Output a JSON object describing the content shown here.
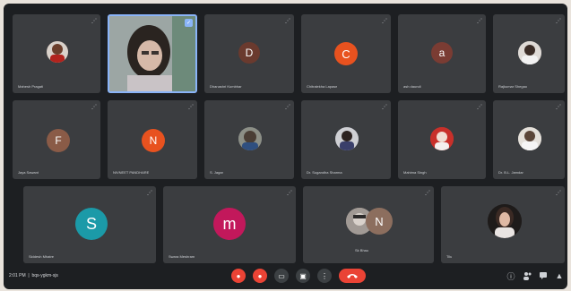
{
  "meeting": {
    "time": "2:01 PM",
    "code": "bqs-ygkm-sjs"
  },
  "participants": [
    {
      "name": "Mahesh Pragati",
      "avatar": "photo",
      "color": "#7a4b38"
    },
    {
      "name": "",
      "avatar": "video",
      "color": "#9aa3a6"
    },
    {
      "name": "Dhanashri Kumbhar",
      "avatar": "D",
      "color": "#6a3a2e"
    },
    {
      "name": "Chitralekha Lapase",
      "avatar": "C",
      "color": "#e8521f"
    },
    {
      "name": "ash daundi",
      "avatar": "a",
      "color": "#7a3c33"
    },
    {
      "name": "Rajkumar Shegao",
      "avatar": "photo",
      "color": "#b9b3ad"
    },
    {
      "name": "Jaya Sawant",
      "avatar": "F",
      "color": "#8a5b47"
    },
    {
      "name": "NIVNEET PANDHARE",
      "avatar": "N",
      "color": "#e8521f"
    },
    {
      "name": "S. Jagar",
      "avatar": "photo",
      "color": "#6d7584"
    },
    {
      "name": "Dr. Sugandha Sharma",
      "avatar": "photo",
      "color": "#4c5468"
    },
    {
      "name": "Mahima Singh",
      "avatar": "photo",
      "color": "#c23a31"
    },
    {
      "name": "Dr. B.L. Jamdar",
      "avatar": "photo",
      "color": "#b8b0a4"
    },
    {
      "name": "Siddesh Mhatre",
      "avatar": "S",
      "color": "#1b9aa8"
    },
    {
      "name": "Swara Meshram",
      "avatar": "m",
      "color": "#c2185b"
    },
    {
      "name": "Sk Bhau",
      "avatar": "group",
      "color": "#9a8c82"
    },
    {
      "name": "Tilu",
      "avatar": "photo",
      "color": "#2a2422"
    }
  ],
  "colors": {
    "background": "#1d1f22",
    "tile": "#3b3d40",
    "danger": "#ea4335",
    "active_border": "#8ab4f8"
  },
  "controls": [
    {
      "icon": "mic-off-icon",
      "glyph": "●"
    },
    {
      "icon": "camera-off-icon",
      "glyph": "●"
    },
    {
      "icon": "captions-icon",
      "glyph": "▭"
    },
    {
      "icon": "present-icon",
      "glyph": "▣"
    },
    {
      "icon": "more-options-icon",
      "glyph": "⋮"
    }
  ],
  "end_call_icon": "end-call-icon"
}
